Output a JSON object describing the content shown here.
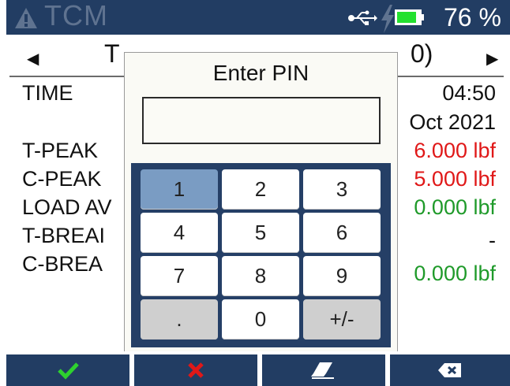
{
  "status": {
    "app_title": "TCM",
    "battery_level": 0.8,
    "battery_text": "76 %",
    "icons": [
      "warning-icon",
      "usb-icon",
      "charging-bolt-icon",
      "battery-icon"
    ]
  },
  "header": {
    "title_left": "T",
    "title_right": "0)",
    "nav_left": "◀",
    "nav_right": "▶"
  },
  "rows": [
    {
      "label": "TIME",
      "value": "04:50"
    },
    {
      "label": "",
      "value": "Oct 2021"
    },
    {
      "label": "T-PEAK",
      "value": "6.000 lbf"
    },
    {
      "label": "C-PEAK",
      "value": "5.000 lbf"
    },
    {
      "label": "LOAD AV",
      "value": "0.000 lbf"
    },
    {
      "label": "T-BREAI",
      "value": "-"
    },
    {
      "label": "C-BREA",
      "value": "0.000 lbf"
    }
  ],
  "dialog": {
    "title": "Enter PIN",
    "pin_value": "",
    "keys": [
      "1",
      "2",
      "3",
      "4",
      "5",
      "6",
      "7",
      "8",
      "9",
      ".",
      "0",
      "+/-"
    ]
  },
  "colors": {
    "bar_bg": "#223d63",
    "peak_red": "#e01818",
    "value_green": "#1f9a2a",
    "selected_key": "#7a9cc3"
  },
  "bottom_bar": {
    "icons": [
      "confirm-check-icon",
      "cancel-x-icon",
      "eraser-icon",
      "backspace-icon"
    ]
  }
}
